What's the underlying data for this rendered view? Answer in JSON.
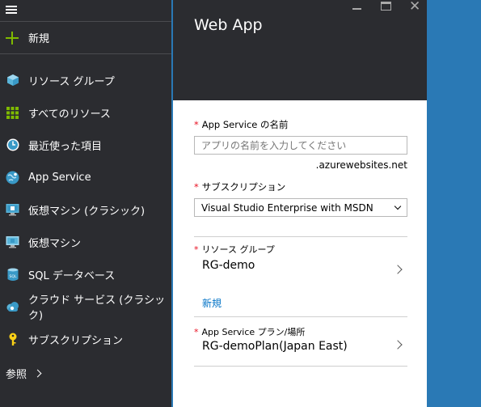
{
  "sidebar": {
    "new_label": "新規",
    "items": [
      {
        "label": "リソース グループ",
        "icon": "resource-group-icon"
      },
      {
        "label": "すべてのリソース",
        "icon": "all-resources-icon"
      },
      {
        "label": "最近使った項目",
        "icon": "recent-clock-icon"
      },
      {
        "label": "App Service",
        "icon": "app-service-globe-icon"
      },
      {
        "label": "仮想マシン (クラシック)",
        "icon": "vm-classic-icon"
      },
      {
        "label": "仮想マシン",
        "icon": "vm-icon"
      },
      {
        "label": "SQL データベース",
        "icon": "sql-database-icon"
      },
      {
        "label": "クラウド サービス (クラシック)",
        "icon": "cloud-service-icon"
      },
      {
        "label": "サブスクリプション",
        "icon": "key-icon"
      }
    ],
    "more_label": "参照"
  },
  "blade": {
    "title": "Web App",
    "app_name": {
      "label": "App Service の名前",
      "placeholder": "アプリの名前を入力してください",
      "value": "",
      "suffix": ".azurewebsites.net"
    },
    "subscription": {
      "label": "サブスクリプション",
      "value": "Visual Studio Enterprise with MSDN"
    },
    "resource_group": {
      "label": "リソース グループ",
      "value": "RG-demo",
      "new_link": "新規"
    },
    "plan": {
      "label": "App Service プラン/場所",
      "value": "RG-demoPlan(Japan East)"
    }
  },
  "colors": {
    "accent_green": "#7fba00",
    "link_blue": "#0072c6",
    "required_red": "#e81123",
    "dark_bg": "#2b2c30",
    "azure_blue": "#2a79b5"
  }
}
